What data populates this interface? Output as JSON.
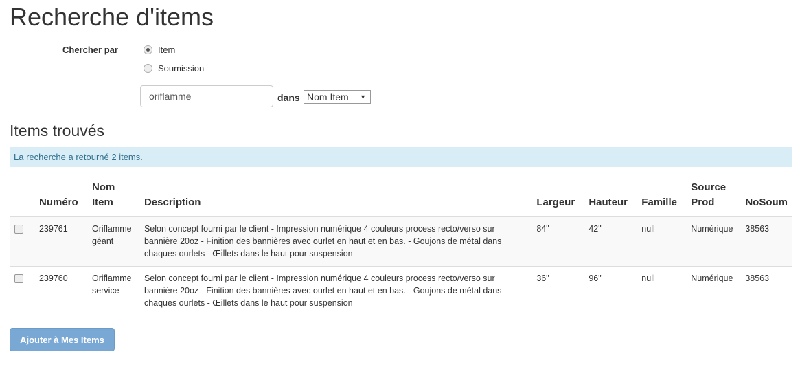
{
  "title": "Recherche d'items",
  "search": {
    "label": "Chercher par",
    "options": [
      "Item",
      "Soumission"
    ],
    "selected": "Item",
    "value": "oriflamme",
    "dans": "dans",
    "field": "Nom Item"
  },
  "results": {
    "heading": "Items trouvés",
    "message": "La recherche a retourné 2 items.",
    "columns": [
      "Numéro",
      "Nom Item",
      "Description",
      "Largeur",
      "Hauteur",
      "Famille",
      "Source Prod",
      "NoSoum"
    ],
    "rows": [
      {
        "numero": "239761",
        "nom": "Oriflamme géant",
        "description": "Selon concept fourni par le client - Impression numérique 4 couleurs process recto/verso sur bannière 20oz - Finition des bannières avec ourlet en haut et en bas. - Goujons de métal dans chaques ourlets - Œillets dans le haut pour suspension",
        "largeur": "84\"",
        "hauteur": "42\"",
        "famille": "null",
        "source": "Numérique",
        "nosoum": "38563"
      },
      {
        "numero": "239760",
        "nom": "Oriflamme service",
        "description": "Selon concept fourni par le client - Impression numérique 4 couleurs process recto/verso sur bannière 20oz - Finition des bannières avec ourlet en haut et en bas. - Goujons de métal dans chaques ourlets - Œillets dans le haut pour suspension",
        "largeur": "36\"",
        "hauteur": "96\"",
        "famille": "null",
        "source": "Numérique",
        "nosoum": "38563"
      }
    ]
  },
  "add_button": "Ajouter à Mes Items"
}
